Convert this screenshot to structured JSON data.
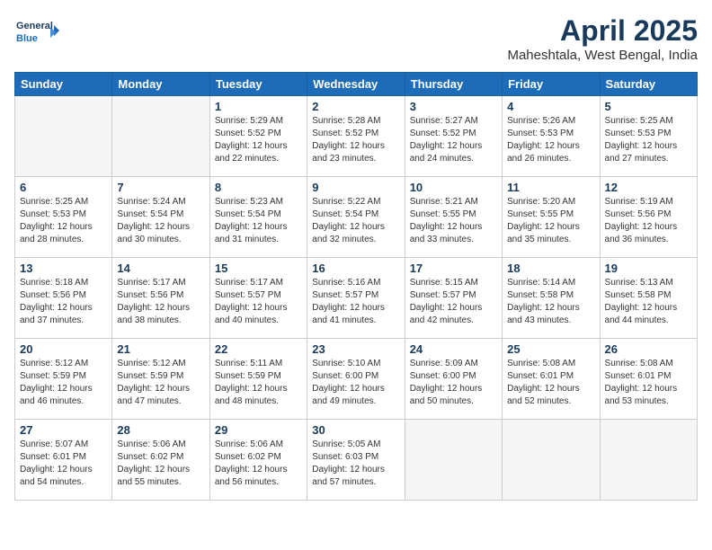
{
  "header": {
    "logo_line1": "General",
    "logo_line2": "Blue",
    "month": "April 2025",
    "location": "Maheshtala, West Bengal, India"
  },
  "weekdays": [
    "Sunday",
    "Monday",
    "Tuesday",
    "Wednesday",
    "Thursday",
    "Friday",
    "Saturday"
  ],
  "weeks": [
    [
      {
        "day": "",
        "sunrise": "",
        "sunset": "",
        "daylight": ""
      },
      {
        "day": "",
        "sunrise": "",
        "sunset": "",
        "daylight": ""
      },
      {
        "day": "1",
        "sunrise": "Sunrise: 5:29 AM",
        "sunset": "Sunset: 5:52 PM",
        "daylight": "Daylight: 12 hours and 22 minutes."
      },
      {
        "day": "2",
        "sunrise": "Sunrise: 5:28 AM",
        "sunset": "Sunset: 5:52 PM",
        "daylight": "Daylight: 12 hours and 23 minutes."
      },
      {
        "day": "3",
        "sunrise": "Sunrise: 5:27 AM",
        "sunset": "Sunset: 5:52 PM",
        "daylight": "Daylight: 12 hours and 24 minutes."
      },
      {
        "day": "4",
        "sunrise": "Sunrise: 5:26 AM",
        "sunset": "Sunset: 5:53 PM",
        "daylight": "Daylight: 12 hours and 26 minutes."
      },
      {
        "day": "5",
        "sunrise": "Sunrise: 5:25 AM",
        "sunset": "Sunset: 5:53 PM",
        "daylight": "Daylight: 12 hours and 27 minutes."
      }
    ],
    [
      {
        "day": "6",
        "sunrise": "Sunrise: 5:25 AM",
        "sunset": "Sunset: 5:53 PM",
        "daylight": "Daylight: 12 hours and 28 minutes."
      },
      {
        "day": "7",
        "sunrise": "Sunrise: 5:24 AM",
        "sunset": "Sunset: 5:54 PM",
        "daylight": "Daylight: 12 hours and 30 minutes."
      },
      {
        "day": "8",
        "sunrise": "Sunrise: 5:23 AM",
        "sunset": "Sunset: 5:54 PM",
        "daylight": "Daylight: 12 hours and 31 minutes."
      },
      {
        "day": "9",
        "sunrise": "Sunrise: 5:22 AM",
        "sunset": "Sunset: 5:54 PM",
        "daylight": "Daylight: 12 hours and 32 minutes."
      },
      {
        "day": "10",
        "sunrise": "Sunrise: 5:21 AM",
        "sunset": "Sunset: 5:55 PM",
        "daylight": "Daylight: 12 hours and 33 minutes."
      },
      {
        "day": "11",
        "sunrise": "Sunrise: 5:20 AM",
        "sunset": "Sunset: 5:55 PM",
        "daylight": "Daylight: 12 hours and 35 minutes."
      },
      {
        "day": "12",
        "sunrise": "Sunrise: 5:19 AM",
        "sunset": "Sunset: 5:56 PM",
        "daylight": "Daylight: 12 hours and 36 minutes."
      }
    ],
    [
      {
        "day": "13",
        "sunrise": "Sunrise: 5:18 AM",
        "sunset": "Sunset: 5:56 PM",
        "daylight": "Daylight: 12 hours and 37 minutes."
      },
      {
        "day": "14",
        "sunrise": "Sunrise: 5:17 AM",
        "sunset": "Sunset: 5:56 PM",
        "daylight": "Daylight: 12 hours and 38 minutes."
      },
      {
        "day": "15",
        "sunrise": "Sunrise: 5:17 AM",
        "sunset": "Sunset: 5:57 PM",
        "daylight": "Daylight: 12 hours and 40 minutes."
      },
      {
        "day": "16",
        "sunrise": "Sunrise: 5:16 AM",
        "sunset": "Sunset: 5:57 PM",
        "daylight": "Daylight: 12 hours and 41 minutes."
      },
      {
        "day": "17",
        "sunrise": "Sunrise: 5:15 AM",
        "sunset": "Sunset: 5:57 PM",
        "daylight": "Daylight: 12 hours and 42 minutes."
      },
      {
        "day": "18",
        "sunrise": "Sunrise: 5:14 AM",
        "sunset": "Sunset: 5:58 PM",
        "daylight": "Daylight: 12 hours and 43 minutes."
      },
      {
        "day": "19",
        "sunrise": "Sunrise: 5:13 AM",
        "sunset": "Sunset: 5:58 PM",
        "daylight": "Daylight: 12 hours and 44 minutes."
      }
    ],
    [
      {
        "day": "20",
        "sunrise": "Sunrise: 5:12 AM",
        "sunset": "Sunset: 5:59 PM",
        "daylight": "Daylight: 12 hours and 46 minutes."
      },
      {
        "day": "21",
        "sunrise": "Sunrise: 5:12 AM",
        "sunset": "Sunset: 5:59 PM",
        "daylight": "Daylight: 12 hours and 47 minutes."
      },
      {
        "day": "22",
        "sunrise": "Sunrise: 5:11 AM",
        "sunset": "Sunset: 5:59 PM",
        "daylight": "Daylight: 12 hours and 48 minutes."
      },
      {
        "day": "23",
        "sunrise": "Sunrise: 5:10 AM",
        "sunset": "Sunset: 6:00 PM",
        "daylight": "Daylight: 12 hours and 49 minutes."
      },
      {
        "day": "24",
        "sunrise": "Sunrise: 5:09 AM",
        "sunset": "Sunset: 6:00 PM",
        "daylight": "Daylight: 12 hours and 50 minutes."
      },
      {
        "day": "25",
        "sunrise": "Sunrise: 5:08 AM",
        "sunset": "Sunset: 6:01 PM",
        "daylight": "Daylight: 12 hours and 52 minutes."
      },
      {
        "day": "26",
        "sunrise": "Sunrise: 5:08 AM",
        "sunset": "Sunset: 6:01 PM",
        "daylight": "Daylight: 12 hours and 53 minutes."
      }
    ],
    [
      {
        "day": "27",
        "sunrise": "Sunrise: 5:07 AM",
        "sunset": "Sunset: 6:01 PM",
        "daylight": "Daylight: 12 hours and 54 minutes."
      },
      {
        "day": "28",
        "sunrise": "Sunrise: 5:06 AM",
        "sunset": "Sunset: 6:02 PM",
        "daylight": "Daylight: 12 hours and 55 minutes."
      },
      {
        "day": "29",
        "sunrise": "Sunrise: 5:06 AM",
        "sunset": "Sunset: 6:02 PM",
        "daylight": "Daylight: 12 hours and 56 minutes."
      },
      {
        "day": "30",
        "sunrise": "Sunrise: 5:05 AM",
        "sunset": "Sunset: 6:03 PM",
        "daylight": "Daylight: 12 hours and 57 minutes."
      },
      {
        "day": "",
        "sunrise": "",
        "sunset": "",
        "daylight": ""
      },
      {
        "day": "",
        "sunrise": "",
        "sunset": "",
        "daylight": ""
      },
      {
        "day": "",
        "sunrise": "",
        "sunset": "",
        "daylight": ""
      }
    ]
  ]
}
